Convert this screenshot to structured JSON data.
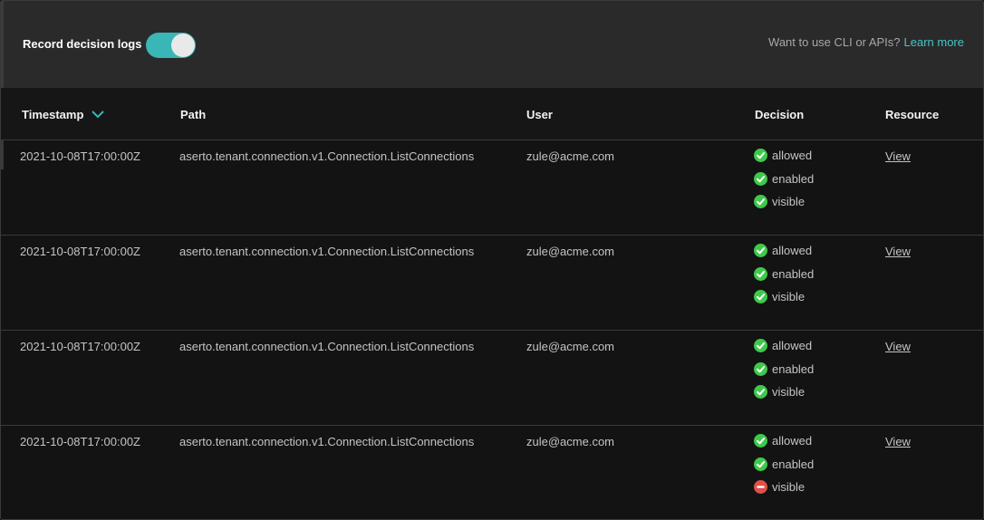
{
  "toolbar": {
    "record_label": "Record decision logs",
    "record_enabled": true,
    "cli_prompt": "Want to use CLI or APIs?",
    "learn_more": "Learn more",
    "accent_color": "#3ab6b6"
  },
  "table": {
    "columns": {
      "timestamp": "Timestamp",
      "path": "Path",
      "user": "User",
      "decision": "Decision",
      "resource": "Resource"
    },
    "sort_icon": "chevron-down-icon",
    "rows": [
      {
        "timestamp": "2021-10-08T17:00:00Z",
        "path": "aserto.tenant.connection.v1.Connection.ListConnections",
        "user": "zule@acme.com",
        "decisions": [
          {
            "label": "allowed",
            "status": "ok",
            "icon": "check-circle-icon"
          },
          {
            "label": "enabled",
            "status": "ok",
            "icon": "check-circle-icon"
          },
          {
            "label": "visible",
            "status": "ok",
            "icon": "check-circle-icon"
          }
        ],
        "resource": "View"
      },
      {
        "timestamp": "2021-10-08T17:00:00Z",
        "path": "aserto.tenant.connection.v1.Connection.ListConnections",
        "user": "zule@acme.com",
        "decisions": [
          {
            "label": "allowed",
            "status": "ok",
            "icon": "check-circle-icon"
          },
          {
            "label": "enabled",
            "status": "ok",
            "icon": "check-circle-icon"
          },
          {
            "label": "visible",
            "status": "ok",
            "icon": "check-circle-icon"
          }
        ],
        "resource": "View"
      },
      {
        "timestamp": "2021-10-08T17:00:00Z",
        "path": "aserto.tenant.connection.v1.Connection.ListConnections",
        "user": "zule@acme.com",
        "decisions": [
          {
            "label": "allowed",
            "status": "ok",
            "icon": "check-circle-icon"
          },
          {
            "label": "enabled",
            "status": "ok",
            "icon": "check-circle-icon"
          },
          {
            "label": "visible",
            "status": "ok",
            "icon": "check-circle-icon"
          }
        ],
        "resource": "View"
      },
      {
        "timestamp": "2021-10-08T17:00:00Z",
        "path": "aserto.tenant.connection.v1.Connection.ListConnections",
        "user": "zule@acme.com",
        "decisions": [
          {
            "label": "allowed",
            "status": "ok",
            "icon": "check-circle-icon"
          },
          {
            "label": "enabled",
            "status": "ok",
            "icon": "check-circle-icon"
          },
          {
            "label": "visible",
            "status": "denied",
            "icon": "no-entry-icon"
          }
        ],
        "resource": "View"
      }
    ]
  },
  "colors": {
    "ok": "#3ec94a",
    "denied": "#e0504a"
  }
}
